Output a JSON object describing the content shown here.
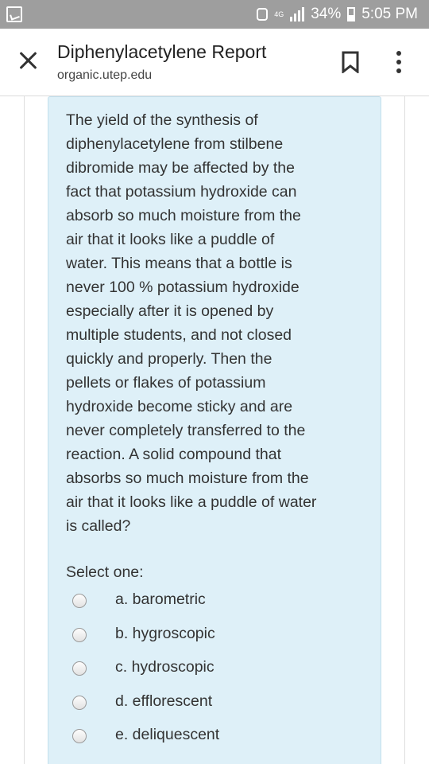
{
  "status_bar": {
    "network_type": "4G",
    "battery_percent": "34%",
    "time": "5:05 PM"
  },
  "header": {
    "title": "Diphenylacetylene Report",
    "url": "organic.utep.edu"
  },
  "question": {
    "text": "The yield of the synthesis of\ndiphenylacetylene from stilbene\ndibromide may be affected by the\nfact that potassium hydroxide can\nabsorb so much moisture from the\nair that it looks like a puddle of\nwater.  This means that a bottle is\nnever 100 % potassium hydroxide\nespecially after it is opened by\nmultiple students, and not closed\nquickly and properly.  Then the\npellets or flakes of potassium\nhydroxide become sticky and are\nnever completely transferred to the\nreaction.  A solid compound that\nabsorbs so much moisture from the\nair that it looks like a puddle of water\nis called?",
    "select_label": "Select one:",
    "options": [
      {
        "label": "a. barometric",
        "selected": false
      },
      {
        "label": "b. hygroscopic",
        "selected": false
      },
      {
        "label": "c. hydroscopic",
        "selected": false
      },
      {
        "label": "d. efflorescent",
        "selected": false
      },
      {
        "label": "e. deliquescent",
        "selected": false
      }
    ]
  }
}
